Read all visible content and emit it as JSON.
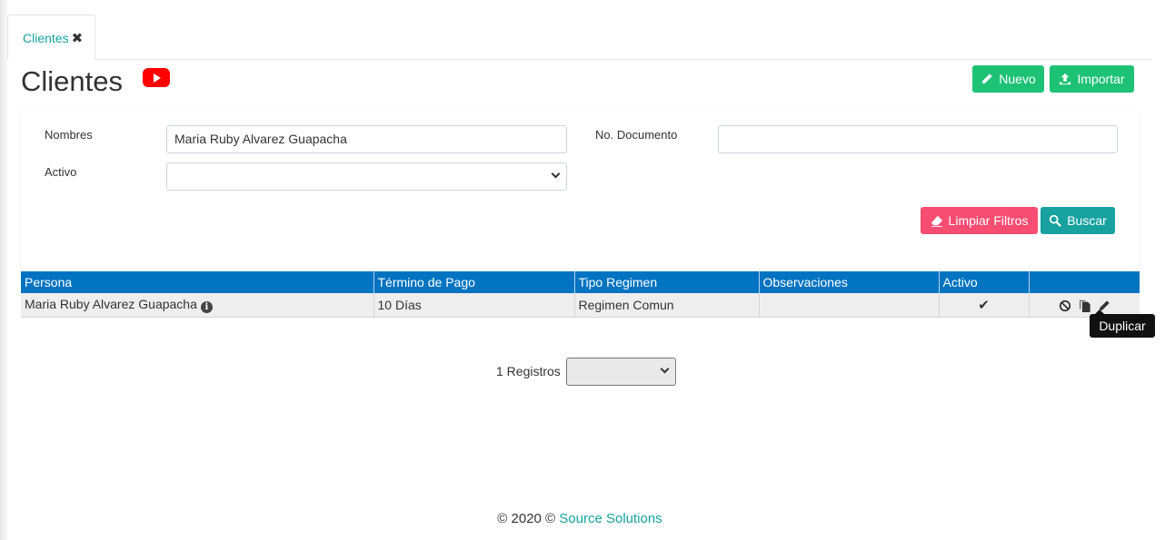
{
  "tabs": [
    {
      "label": "Clientes",
      "close": "✖"
    }
  ],
  "page": {
    "title": "Clientes"
  },
  "header_buttons": {
    "nuevo": "Nuevo",
    "importar": "Importar"
  },
  "filters": {
    "nombres_label": "Nombres",
    "nombres_value": "Maria Ruby Alvarez Guapacha",
    "documento_label": "No. Documento",
    "documento_value": "",
    "activo_label": "Activo",
    "activo_value": "",
    "limpiar": "Limpiar Filtros",
    "buscar": "Buscar"
  },
  "table": {
    "columns": [
      "Persona",
      "Término de Pago",
      "Tipo Regimen",
      "Observaciones",
      "Activo",
      ""
    ],
    "rows": [
      {
        "persona": "Maria Ruby Alvarez Guapacha",
        "termino": "10 Días",
        "regimen": "Regimen Comun",
        "observaciones": "",
        "activo": "✔"
      }
    ]
  },
  "tooltip": "Duplicar",
  "pagination": {
    "registros": "1 Registros",
    "selected": ""
  },
  "footer": {
    "prefix": "© 2020 © ",
    "link": "Source Solutions"
  },
  "colors": {
    "accent": "#17a2a0",
    "header_blue": "#0073c1",
    "green": "#1ec275",
    "pink": "#f74d72",
    "youtube_red": "#ff0000"
  },
  "icons": [
    "youtube-icon",
    "pencil-icon",
    "upload-icon",
    "eraser-icon",
    "search-icon",
    "info-icon",
    "check-icon",
    "ban-icon",
    "copy-icon",
    "edit-icon"
  ]
}
